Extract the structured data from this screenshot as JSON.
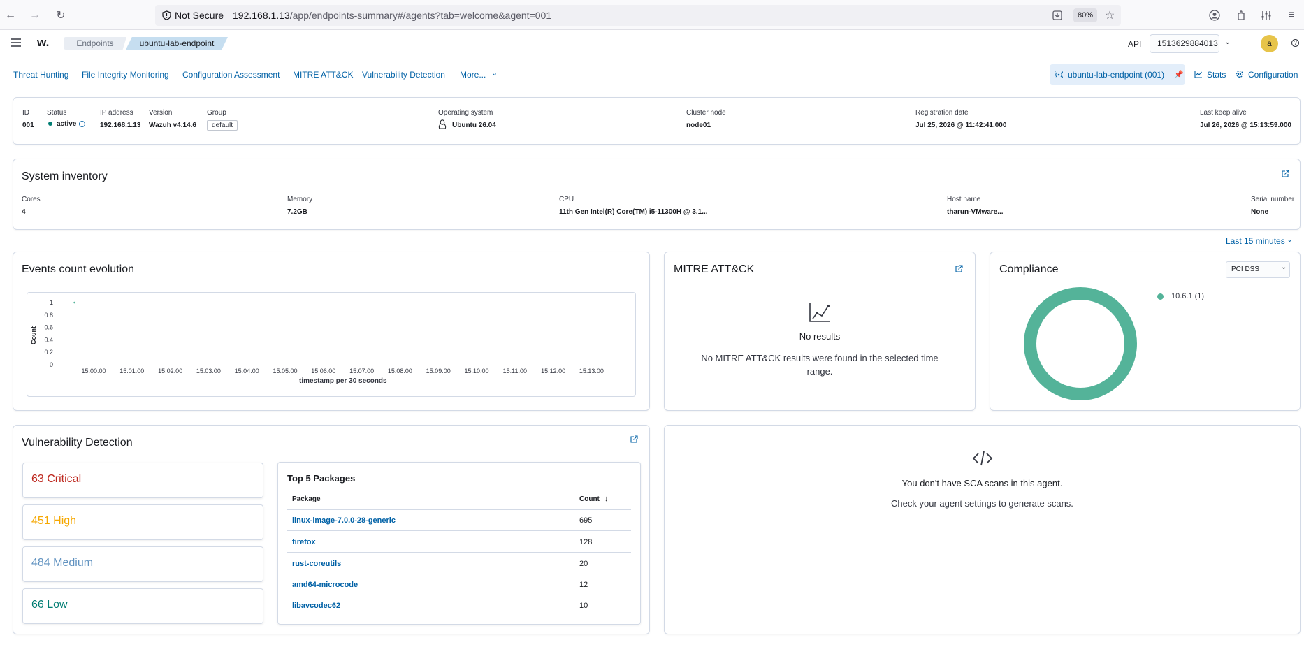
{
  "browser": {
    "not_secure": "Not Secure",
    "url_host": "192.168.1.13",
    "url_path": "/app/endpoints-summary#/agents?tab=welcome&agent=001",
    "zoom": "80%"
  },
  "header": {
    "logo": "w.",
    "breadcrumb": [
      "Endpoints",
      "ubuntu-lab-endpoint"
    ],
    "api_label": "API",
    "api_value": "1513629884013",
    "avatar_letter": "a"
  },
  "nav": {
    "tabs": [
      "Threat Hunting",
      "File Integrity Monitoring",
      "Configuration Assessment",
      "MITRE ATT&CK",
      "Vulnerability Detection",
      "More..."
    ],
    "agent_pill": "ubuntu-lab-endpoint (001)",
    "stats": "Stats",
    "configuration": "Configuration"
  },
  "agent_info": {
    "id_label": "ID",
    "id": "001",
    "status_label": "Status",
    "status": "active",
    "ip_label": "IP address",
    "ip": "192.168.1.13",
    "version_label": "Version",
    "version": "Wazuh v4.14.6",
    "group_label": "Group",
    "group": "default",
    "os_label": "Operating system",
    "os": "Ubuntu 26.04",
    "cluster_label": "Cluster node",
    "cluster": "node01",
    "reg_label": "Registration date",
    "reg": "Jul 25, 2026 @ 11:42:41.000",
    "keepalive_label": "Last keep alive",
    "keepalive": "Jul 26, 2026 @ 15:13:59.000"
  },
  "inventory": {
    "title": "System inventory",
    "cores_label": "Cores",
    "cores": "4",
    "memory_label": "Memory",
    "memory": "7.2GB",
    "cpu_label": "CPU",
    "cpu": "11th Gen Intel(R) Core(TM) i5-11300H @ 3.1...",
    "host_label": "Host name",
    "host": "tharun-VMware...",
    "serial_label": "Serial number",
    "serial": "None"
  },
  "time_filter": "Last 15 minutes",
  "events": {
    "title": "Events count evolution"
  },
  "chart_data": {
    "type": "line",
    "title": "",
    "xlabel": "timestamp per 30 seconds",
    "ylabel": "Count",
    "x_ticks": [
      "15:00:00",
      "15:01:00",
      "15:02:00",
      "15:03:00",
      "15:04:00",
      "15:05:00",
      "15:06:00",
      "15:07:00",
      "15:08:00",
      "15:09:00",
      "15:10:00",
      "15:11:00",
      "15:12:00",
      "15:13:00"
    ],
    "y_ticks": [
      0,
      0.2,
      0.4,
      0.6,
      0.8,
      1
    ],
    "ylim": [
      0,
      1
    ],
    "series": [
      {
        "x": [
          "14:59:30"
        ],
        "values": [
          1
        ]
      }
    ],
    "grid": false
  },
  "mitre": {
    "title": "MITRE ATT&CK",
    "no_results": "No results",
    "message": "No MITRE ATT&CK results were found in the selected time range."
  },
  "compliance": {
    "title": "Compliance",
    "select": "PCI DSS",
    "legend": "10.6.1 (1)",
    "color": "#54b399"
  },
  "vulnerabilities": {
    "title": "Vulnerability Detection",
    "critical": "63 Critical",
    "high": "451 High",
    "medium": "484 Medium",
    "low": "66 Low",
    "colors": {
      "critical": "#bd271e",
      "high": "#f5a700",
      "medium": "#6092c0",
      "low": "#017d73"
    },
    "top5_title": "Top 5 Packages",
    "col_package": "Package",
    "col_count": "Count",
    "rows": [
      {
        "package": "linux-image-7.0.0-28-generic",
        "count": "695"
      },
      {
        "package": "firefox",
        "count": "128"
      },
      {
        "package": "rust-coreutils",
        "count": "20"
      },
      {
        "package": "amd64-microcode",
        "count": "12"
      },
      {
        "package": "libavcodec62",
        "count": "10"
      }
    ]
  },
  "sca": {
    "title": "You don't have SCA scans in this agent.",
    "message": "Check your agent settings to generate scans."
  }
}
